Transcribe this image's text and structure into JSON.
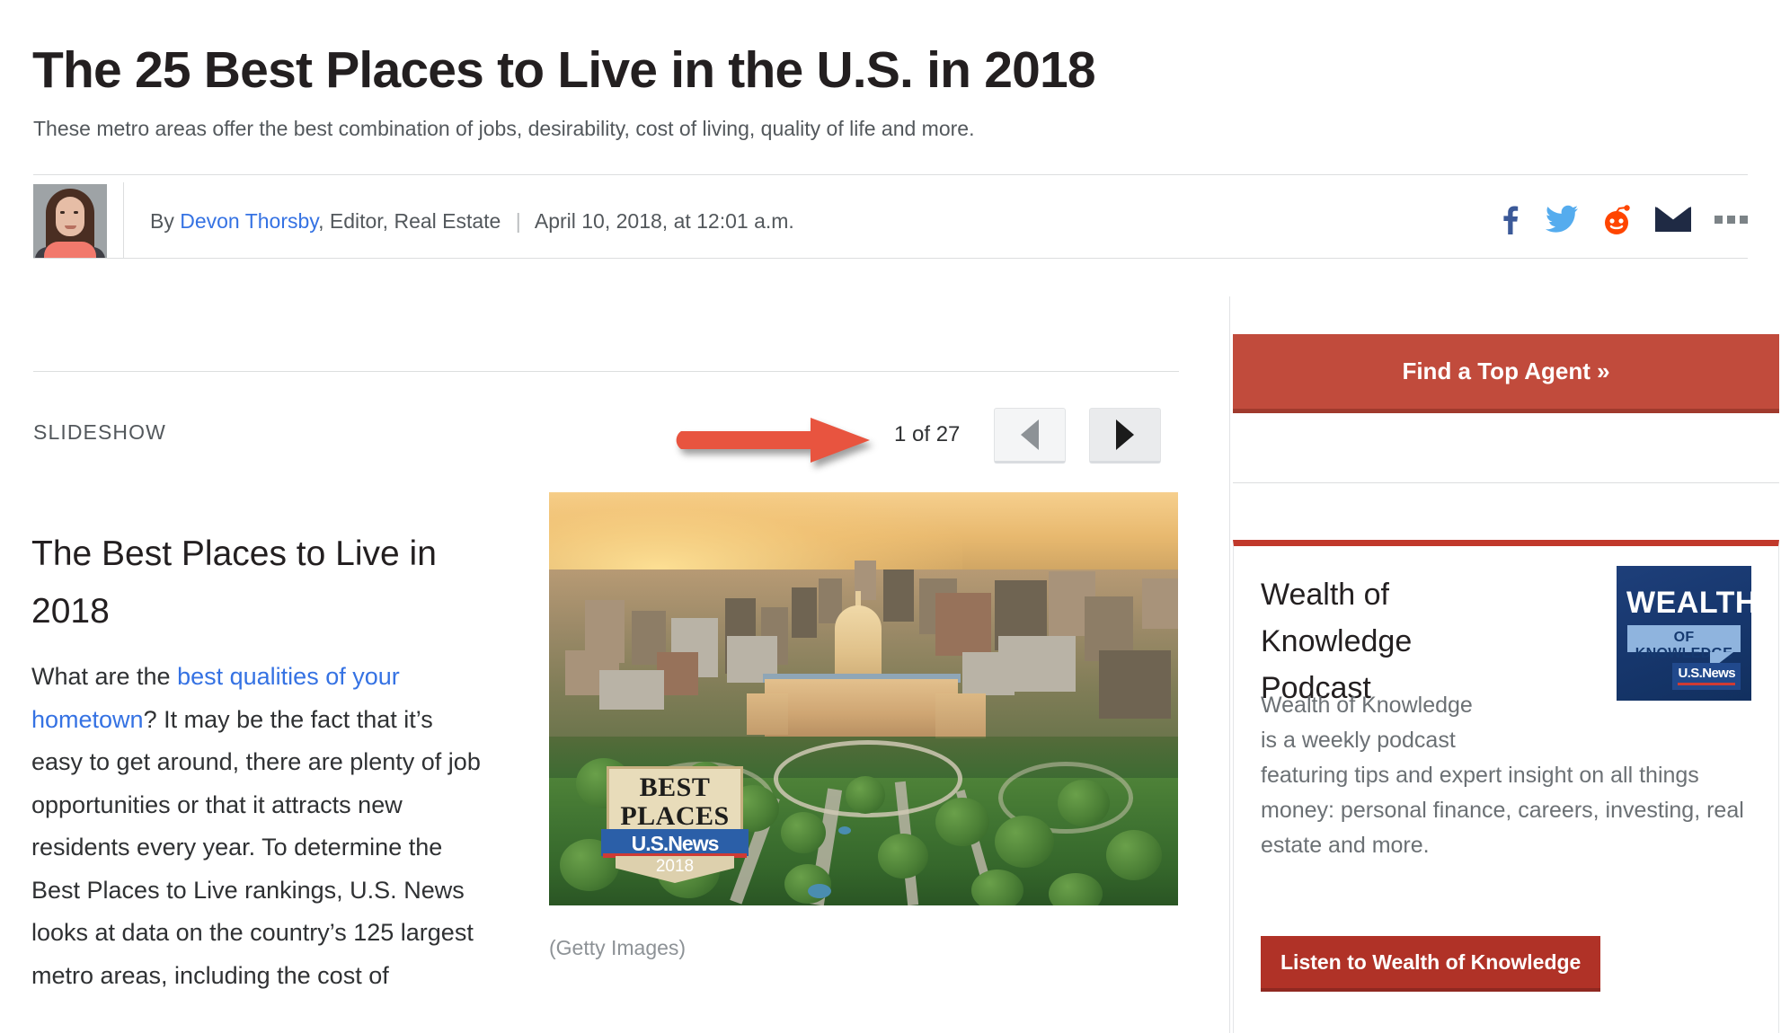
{
  "article": {
    "headline": "The 25 Best Places to Live in the U.S. in 2018",
    "dek": "These metro areas offer the best combination of jobs, desirability, cost of living, quality of life and more."
  },
  "byline": {
    "prefix": "By",
    "author": "Devon Thorsby",
    "role": ", Editor, Real Estate",
    "separator": "|",
    "timestamp": "April 10, 2018, at 12:01 a.m.",
    "avatar_alt": "Devon Thorsby"
  },
  "social": {
    "facebook": "facebook-icon",
    "twitter": "twitter-icon",
    "reddit": "reddit-icon",
    "email": "email-icon",
    "more": "more-options-icon",
    "colors": {
      "facebook": "#3b5998",
      "twitter": "#55acee",
      "reddit": "#ff4500",
      "email": "#1f2a44",
      "more": "#7c8387"
    }
  },
  "slideshow": {
    "label": "SLIDESHOW",
    "counter": "1 of 27",
    "prev_label": "Previous slide",
    "next_label": "Next slide",
    "slide_title": "The Best Places to Live in 2018",
    "body_part1": "What are the ",
    "body_link": "best qualities of your hometown",
    "body_part2": "? It may be the fact that it’s easy to get around, there are plenty of job opportunities or that it attracts new residents every year. To determine the Best Places to Live rankings, U.S. News looks at data on the country’s 125 largest metro areas, including the cost of",
    "caption": "(Getty Images)",
    "annotation": "red-arrow-annotation",
    "badge": {
      "line1": "BEST",
      "line2": "PLACES",
      "brand": "U.S.News",
      "year": "2018"
    }
  },
  "sidebar": {
    "agent_button": "Find a Top Agent »",
    "podcast": {
      "title": "Wealth of Knowledge Podcast",
      "desc_narrow": "Wealth of Knowledge is a weekly podcast",
      "desc_wide": "featuring tips and expert insight on all things money: personal finance, careers, investing, real estate and more.",
      "listen_button": "Listen to Wealth of Knowledge",
      "logo": {
        "word1": "WEALTH",
        "word2": "OF KNOWLEDGE",
        "brand": "U.S.News"
      }
    }
  },
  "colors": {
    "accent_red": "#c14b3c",
    "deep_red": "#b03227",
    "card_top_red": "#c1392b",
    "link_blue": "#3572e3",
    "annotation_red": "#e8543f"
  }
}
